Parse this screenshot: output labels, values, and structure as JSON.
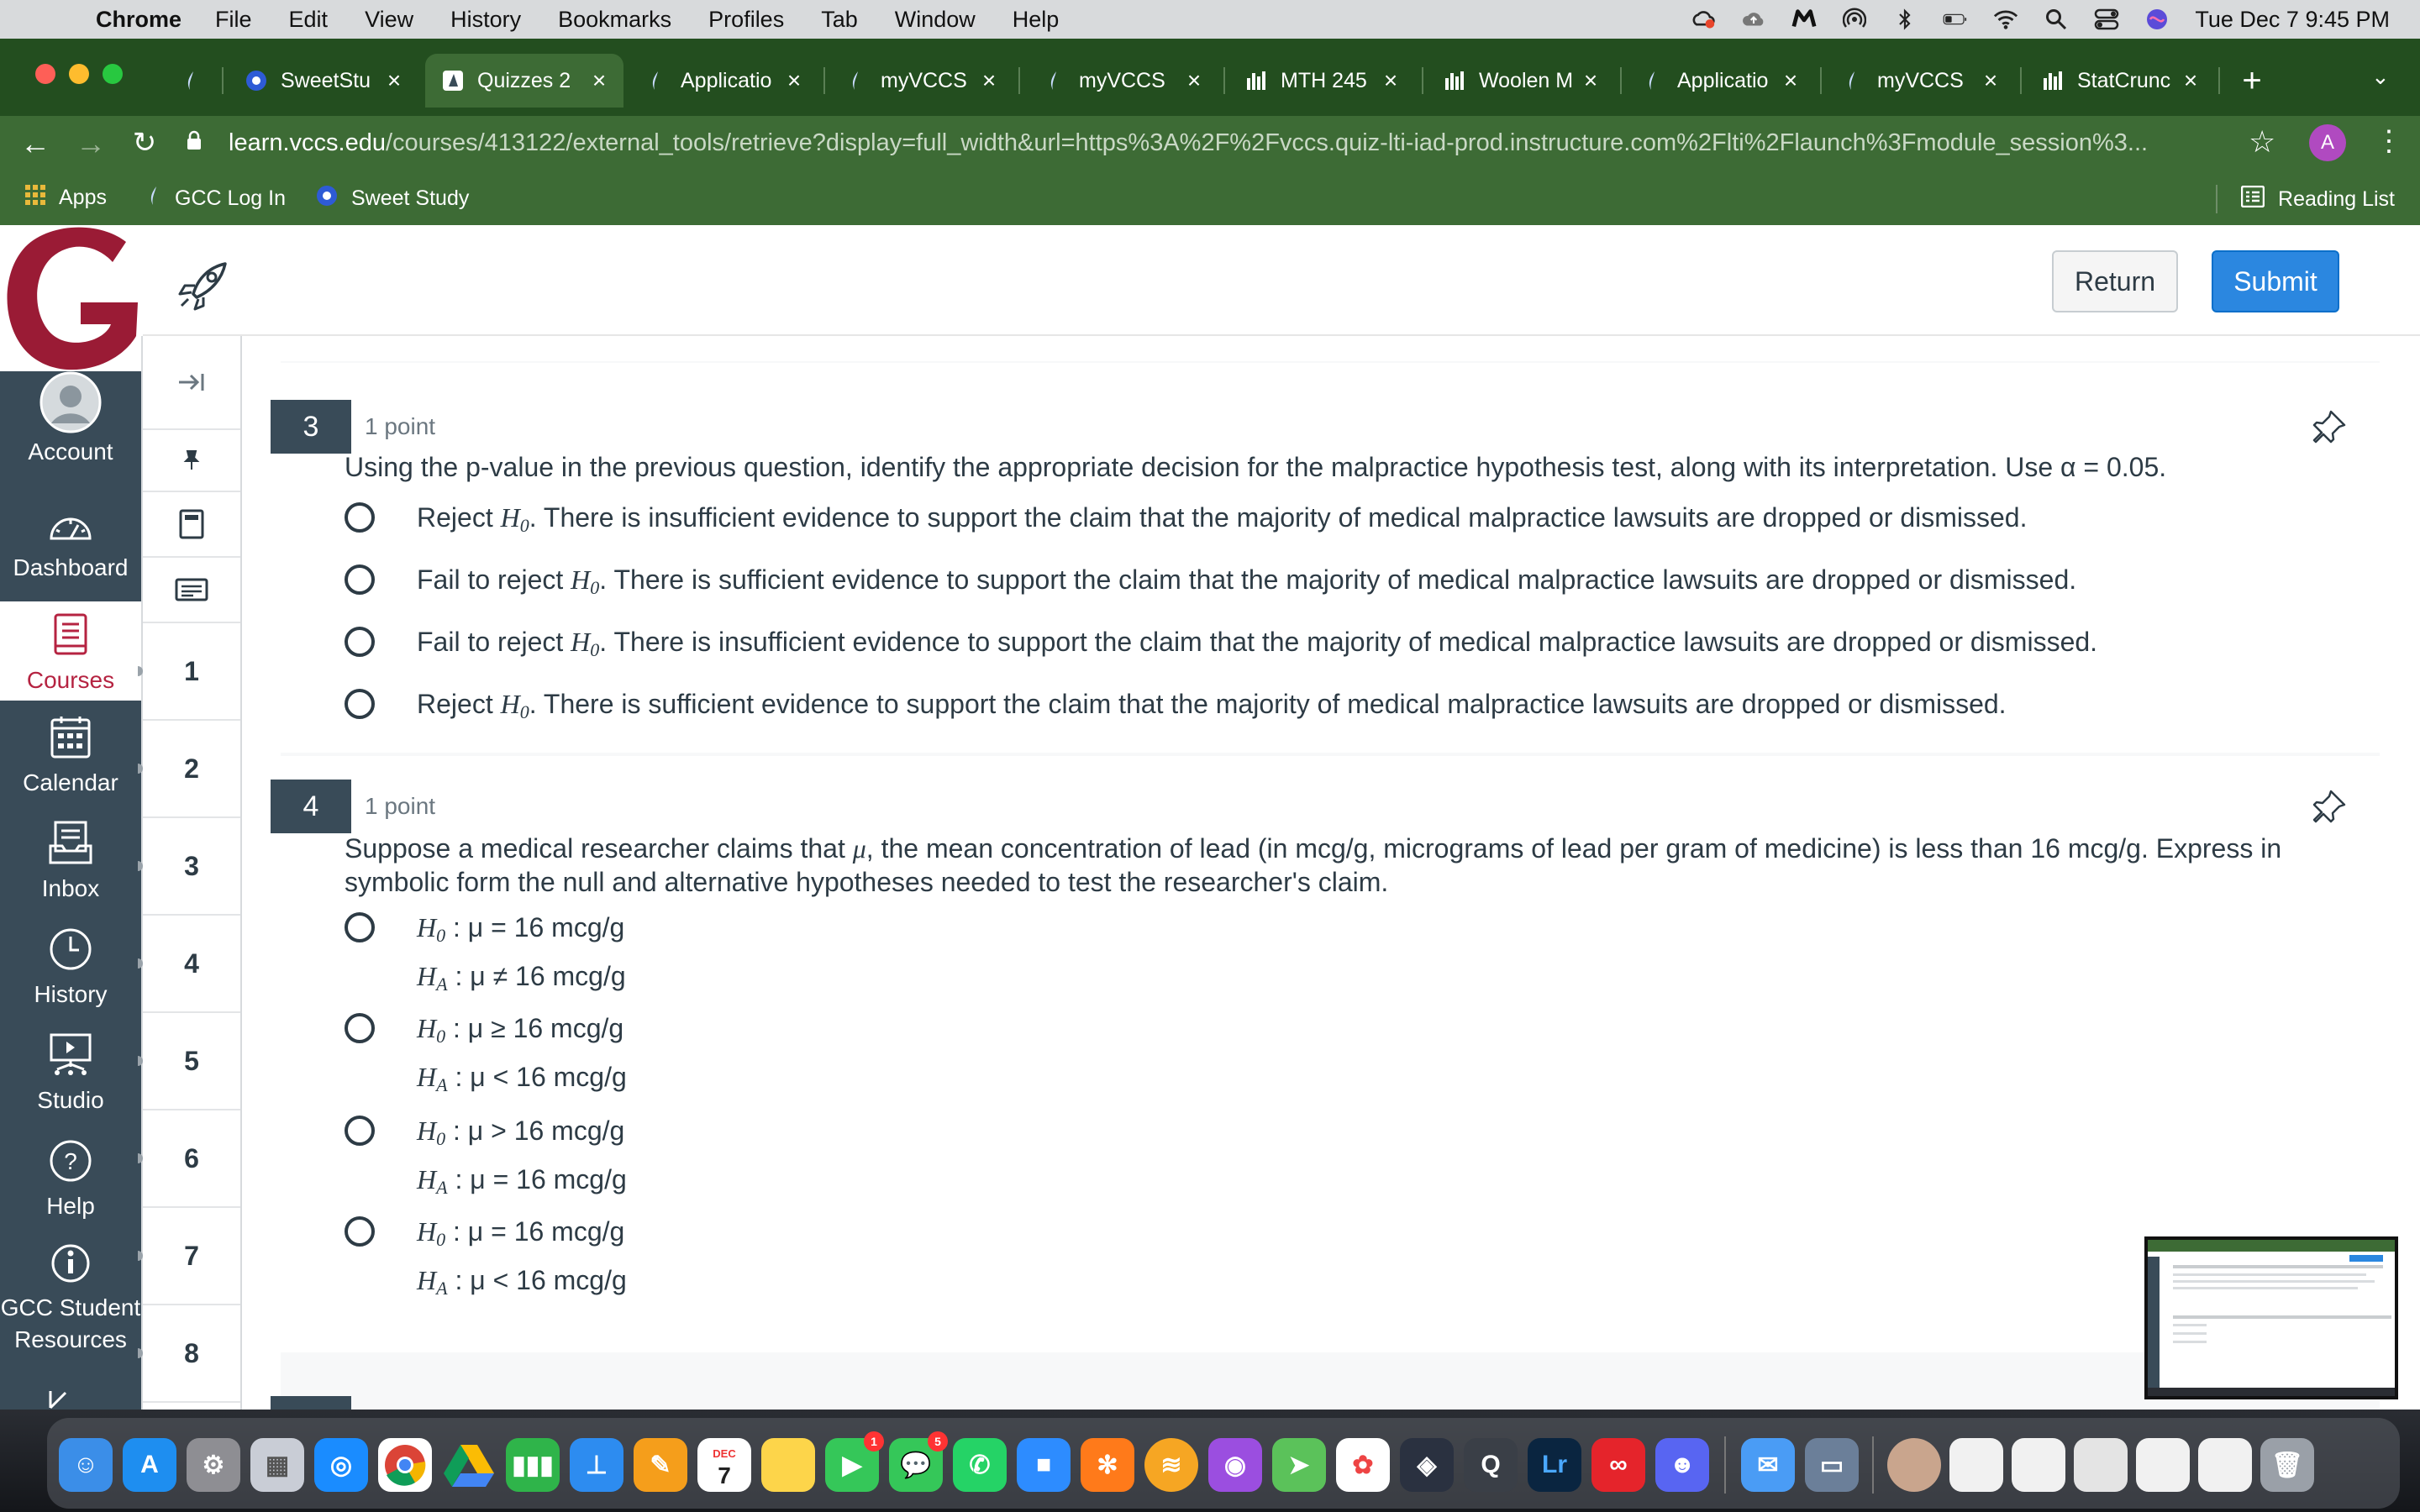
{
  "menubar": {
    "app": "Chrome",
    "menus": [
      "File",
      "Edit",
      "View",
      "History",
      "Bookmarks",
      "Profiles",
      "Tab",
      "Window",
      "Help"
    ],
    "clock": "Tue Dec 7  9:45 PM"
  },
  "browser": {
    "tabs": [
      {
        "title": ""
      },
      {
        "title": "SweetStu"
      },
      {
        "title": "Quizzes 2"
      },
      {
        "title": "Applicatio"
      },
      {
        "title": "myVCCS"
      },
      {
        "title": "myVCCS"
      },
      {
        "title": "MTH 245"
      },
      {
        "title": "Woolen M"
      },
      {
        "title": "Applicatio"
      },
      {
        "title": "myVCCS"
      },
      {
        "title": "StatCrunc"
      }
    ],
    "url_host": "learn.vccs.edu",
    "url_path": "/courses/413122/external_tools/retrieve?display=full_width&url=https%3A%2F%2Fvccs.quiz-lti-iad-prod.instructure.com%2Flti%2Flaunch%3Fmodule_session%3...",
    "profile_initial": "A",
    "bookmarks": [
      "Apps",
      "GCC Log In",
      "Sweet Study"
    ],
    "reading_list": "Reading List"
  },
  "header": {
    "return_label": "Return",
    "submit_label": "Submit"
  },
  "global_nav": [
    {
      "label": "Account",
      "icon": "account-icon"
    },
    {
      "label": "Dashboard",
      "icon": "dashboard-icon"
    },
    {
      "label": "Courses",
      "icon": "courses-icon"
    },
    {
      "label": "Calendar",
      "icon": "calendar-icon"
    },
    {
      "label": "Inbox",
      "icon": "inbox-icon"
    },
    {
      "label": "History",
      "icon": "history-icon"
    },
    {
      "label": "Studio",
      "icon": "studio-icon"
    },
    {
      "label": "Help",
      "icon": "help-icon"
    },
    {
      "label": "GCC Student",
      "label2": "Resources",
      "icon": "info-icon"
    }
  ],
  "quiz_nav": [
    "1",
    "2",
    "3",
    "4",
    "5",
    "6",
    "7",
    "8"
  ],
  "questions": [
    {
      "number": "3",
      "points": "1 point",
      "text": "Using the p-value in the previous question, identify the appropriate decision for the malpractice hypothesis test, along with its interpretation. Use α = 0.05.",
      "options": [
        {
          "lead": "Reject ",
          "rest": ". There is insufficient evidence to support the claim that the majority of medical malpractice lawsuits are dropped or dismissed."
        },
        {
          "lead": "Fail to reject ",
          "rest": ". There is sufficient evidence to support the claim that the majority of medical malpractice lawsuits are dropped or dismissed."
        },
        {
          "lead": "Fail to reject ",
          "rest": ". There is insufficient evidence to support the claim that the majority of medical malpractice lawsuits are dropped or dismissed."
        },
        {
          "lead": "Reject ",
          "rest": ". There is sufficient evidence to support the claim that the majority of medical malpractice lawsuits are dropped or dismissed."
        }
      ]
    },
    {
      "number": "4",
      "points": "1 point",
      "text_a": "Suppose a medical researcher claims that ",
      "text_b": ", the mean concentration of lead (in mcg/g, micrograms of lead per gram of medicine) is less than 16 mcg/g. Express in symbolic form the null and alternative hypotheses needed to test the researcher's claim.",
      "options": [
        {
          "h0": " : μ = 16 mcg/g",
          "ha": " : μ ≠ 16 mcg/g"
        },
        {
          "h0": " : μ ≥ 16 mcg/g",
          "ha": " : μ < 16 mcg/g"
        },
        {
          "h0": " : μ > 16 mcg/g",
          "ha": " : μ = 16 mcg/g"
        },
        {
          "h0": " : μ = 16 mcg/g",
          "ha": " : μ < 16 mcg/g"
        }
      ]
    }
  ],
  "symbols": {
    "H": "H",
    "null_sub": "0",
    "alt_sub": "A",
    "mu": "μ"
  },
  "dock": {
    "calendar_month": "DEC",
    "calendar_day": "7",
    "facetime_badge": "1",
    "messages_badge": "5",
    "lightroom": "Lr"
  }
}
